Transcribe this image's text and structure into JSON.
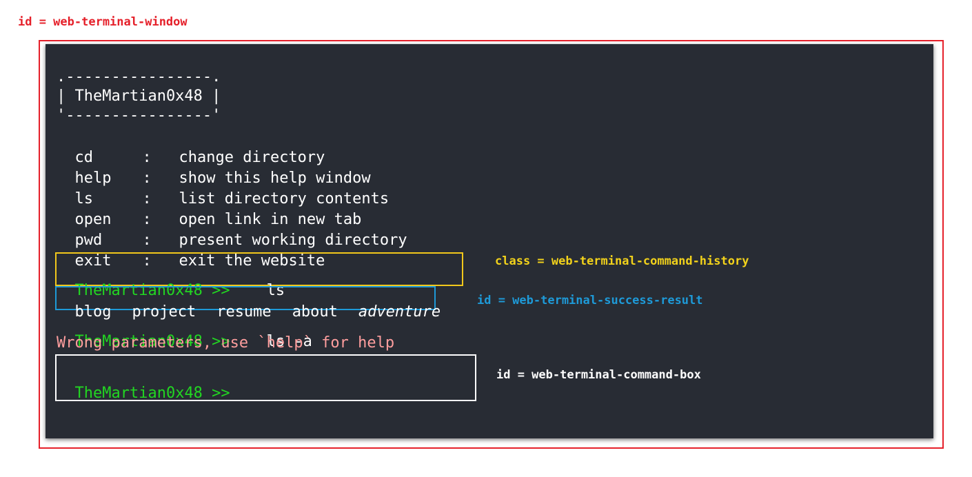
{
  "annotations": {
    "window": "id = web-terminal-window",
    "history": "class = web-terminal-command-history",
    "success": "id = web-terminal-success-result",
    "command_box": "id = web-terminal-command-box"
  },
  "banner": {
    "top": ".----------------.",
    "middle": "| TheMartian0x48 |",
    "bottom": "'----------------'"
  },
  "help": [
    {
      "cmd": "cd",
      "sep": ":",
      "desc": "change directory"
    },
    {
      "cmd": "help",
      "sep": ":",
      "desc": "show this help window"
    },
    {
      "cmd": "ls",
      "sep": ":",
      "desc": "list directory contents"
    },
    {
      "cmd": "open",
      "sep": ":",
      "desc": "open link in new tab"
    },
    {
      "cmd": "pwd",
      "sep": ":",
      "desc": "present working directory"
    },
    {
      "cmd": "exit",
      "sep": ":",
      "desc": "exit the website"
    }
  ],
  "history": [
    {
      "prompt": "TheMartian0x48 >>",
      "command": "ls"
    },
    {
      "prompt": "TheMartian0x48 >>",
      "command": "ls -a"
    }
  ],
  "ls_result": [
    "blog",
    "project",
    "resume",
    "about",
    "adventure"
  ],
  "error_message": "Wrong parameters, use `help` for help",
  "command_box": {
    "prompt": "TheMartian0x48 >>",
    "value": ""
  },
  "colors": {
    "terminal_bg": "#282c34",
    "prompt": "#22d622",
    "error": "#ff9e9e",
    "text": "#ffffff"
  }
}
